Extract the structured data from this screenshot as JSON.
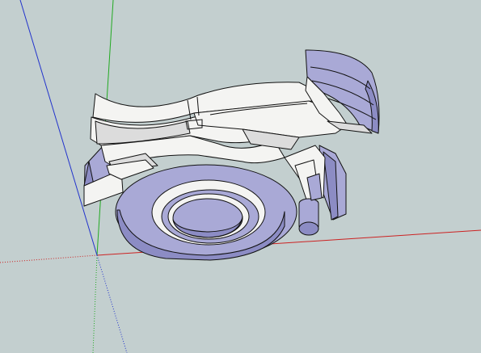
{
  "viewport": {
    "background_color": "#c3cfcf"
  },
  "axes": {
    "red_axis_color": "#cc2222",
    "green_axis_color": "#22aa22",
    "blue_axis_color": "#2233cc"
  },
  "model": {
    "face_color": "#f4f4f2",
    "shade_color": "#dcdcdc",
    "back_face_color": "#a9a9d6",
    "back_face_dark_color": "#8c8cc4",
    "edge_color": "#111111"
  }
}
